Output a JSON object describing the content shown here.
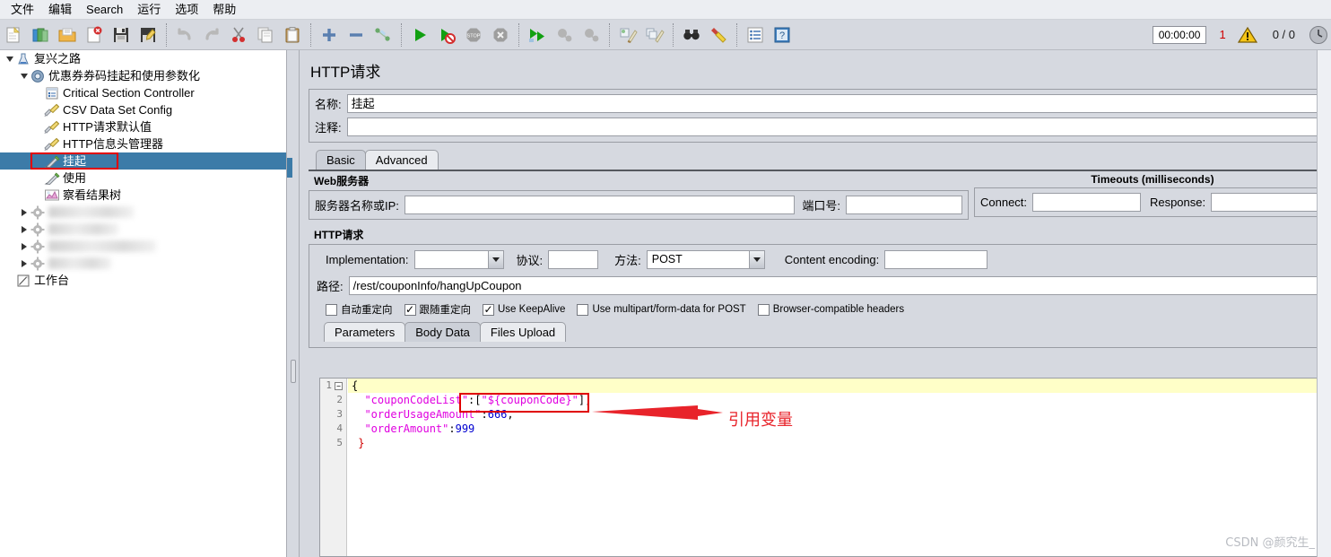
{
  "menubar": {
    "items": [
      {
        "label": "文件",
        "name": "menu-file"
      },
      {
        "label": "编辑",
        "name": "menu-edit"
      },
      {
        "label": "Search",
        "name": "menu-search"
      },
      {
        "label": "运行",
        "name": "menu-run"
      },
      {
        "label": "选项",
        "name": "menu-options"
      },
      {
        "label": "帮助",
        "name": "menu-help"
      }
    ]
  },
  "toolbar": {
    "icons": [
      "new-icon",
      "templates-icon",
      "open-icon",
      "close-icon",
      "save-icon",
      "save-as-icon",
      "undo-icon",
      "redo-icon",
      "cut-icon",
      "copy-icon",
      "paste-icon",
      "expand-icon",
      "collapse-icon",
      "toggle-icon",
      "start-icon",
      "start-no-pause-icon",
      "stop-icon",
      "shutdown-icon",
      "remote-start-icon",
      "remote-stop-icon",
      "remote-shutdown-icon",
      "clear-icon",
      "clear-all-icon",
      "search-icon",
      "search-reset-icon",
      "function-helper-icon",
      "help-icon"
    ],
    "timer": "00:00:00",
    "warning_count": "1",
    "warning_icon": "warning-triangle-icon",
    "thread_counts": "0 / 0",
    "status_icon": "running-indicator-icon"
  },
  "tree": {
    "nodes": [
      {
        "label": "复兴之路",
        "icon": "test-plan-icon",
        "depth": 0,
        "twisty": "open",
        "selected": false,
        "blurred": false
      },
      {
        "label": "优惠券券码挂起和使用参数化",
        "icon": "thread-group-icon",
        "depth": 1,
        "twisty": "open",
        "selected": false,
        "blurred": false
      },
      {
        "label": "Critical Section Controller",
        "icon": "controller-icon",
        "depth": 2,
        "twisty": "none",
        "selected": false,
        "blurred": false
      },
      {
        "label": "CSV Data Set Config",
        "icon": "config-icon",
        "depth": 2,
        "twisty": "none",
        "selected": false,
        "blurred": false
      },
      {
        "label": "HTTP请求默认值",
        "icon": "config-icon",
        "depth": 2,
        "twisty": "none",
        "selected": false,
        "blurred": false
      },
      {
        "label": "HTTP信息头管理器",
        "icon": "config-icon",
        "depth": 2,
        "twisty": "none",
        "selected": false,
        "blurred": false
      },
      {
        "label": "挂起",
        "icon": "sampler-icon",
        "depth": 2,
        "twisty": "none",
        "selected": true,
        "blurred": false
      },
      {
        "label": "使用",
        "icon": "sampler-icon",
        "depth": 2,
        "twisty": "none",
        "selected": false,
        "blurred": false
      },
      {
        "label": "察看结果树",
        "icon": "listener-icon",
        "depth": 2,
        "twisty": "none",
        "selected": false,
        "blurred": false
      },
      {
        "label": "",
        "icon": "gear-icon",
        "depth": 1,
        "twisty": "closed",
        "selected": false,
        "blurred": true,
        "blur_width": 95
      },
      {
        "label": "",
        "icon": "gear-icon",
        "depth": 1,
        "twisty": "closed",
        "selected": false,
        "blurred": true,
        "blur_width": 78
      },
      {
        "label": "",
        "icon": "gear-icon",
        "depth": 1,
        "twisty": "closed",
        "selected": false,
        "blurred": true,
        "blur_width": 120
      },
      {
        "label": "",
        "icon": "gear-icon",
        "depth": 1,
        "twisty": "closed",
        "selected": false,
        "blurred": true,
        "blur_width": 70
      },
      {
        "label": "工作台",
        "icon": "workbench-icon",
        "depth": 0,
        "twisty": "none",
        "selected": false,
        "blurred": false
      }
    ]
  },
  "panel": {
    "title": "HTTP请求",
    "name_label": "名称:",
    "name_value": "挂起",
    "comment_label": "注释:",
    "comment_value": "",
    "tabs": [
      {
        "label": "Basic",
        "active": true
      },
      {
        "label": "Advanced",
        "active": false
      }
    ],
    "webserver": {
      "group_title": "Web服务器",
      "server_label": "服务器名称或IP:",
      "server_value": "",
      "port_label": "端口号:",
      "port_value": ""
    },
    "timeouts": {
      "group_title": "Timeouts (milliseconds)",
      "connect_label": "Connect:",
      "connect_value": "",
      "response_label": "Response:",
      "response_value": ""
    },
    "httprequest": {
      "group_title": "HTTP请求",
      "implementation_label": "Implementation:",
      "implementation_value": "",
      "protocol_label": "协议:",
      "protocol_value": "",
      "method_label": "方法:",
      "method_value": "POST",
      "content_encoding_label": "Content encoding:",
      "content_encoding_value": "",
      "path_label": "路径:",
      "path_value": "/rest/couponInfo/hangUpCoupon"
    },
    "checkboxes": [
      {
        "label": "自动重定向",
        "checked": false,
        "name": "auto-redirect-checkbox"
      },
      {
        "label": "跟随重定向",
        "checked": true,
        "name": "follow-redirect-checkbox"
      },
      {
        "label": "Use KeepAlive",
        "checked": true,
        "name": "keepalive-checkbox"
      },
      {
        "label": "Use multipart/form-data for POST",
        "checked": false,
        "name": "multipart-checkbox"
      },
      {
        "label": "Browser-compatible headers",
        "checked": false,
        "name": "browser-headers-checkbox"
      }
    ],
    "data_tabs": [
      {
        "label": "Parameters",
        "active": false
      },
      {
        "label": "Body Data",
        "active": true
      },
      {
        "label": "Files Upload",
        "active": false
      }
    ]
  },
  "editor": {
    "line_numbers": [
      "1",
      "2",
      "3",
      "4",
      "5"
    ],
    "fold_marker": "⊟",
    "lines": [
      {
        "n": 1,
        "current": true,
        "tokens": [
          {
            "t": "{",
            "c": "p"
          }
        ]
      },
      {
        "n": 2,
        "current": false,
        "tokens": [
          {
            "t": "  ",
            "c": "p"
          },
          {
            "t": "\"couponCodeList\"",
            "c": "str"
          },
          {
            "t": ":[",
            "c": "p"
          },
          {
            "t": "\"${couponCode}\"",
            "c": "str"
          },
          {
            "t": "],",
            "c": "p"
          }
        ]
      },
      {
        "n": 3,
        "current": false,
        "tokens": [
          {
            "t": "  ",
            "c": "p"
          },
          {
            "t": "\"orderUsageAmount\"",
            "c": "str"
          },
          {
            "t": ":",
            "c": "p"
          },
          {
            "t": "666",
            "c": "num"
          },
          {
            "t": ",",
            "c": "p"
          }
        ]
      },
      {
        "n": 4,
        "current": false,
        "tokens": [
          {
            "t": "  ",
            "c": "p"
          },
          {
            "t": "\"orderAmount\"",
            "c": "str"
          },
          {
            "t": ":",
            "c": "p"
          },
          {
            "t": "999",
            "c": "num"
          }
        ]
      },
      {
        "n": 5,
        "current": false,
        "tokens": [
          {
            "t": " ",
            "c": "p"
          },
          {
            "t": "}",
            "c": "brace-hl"
          }
        ]
      }
    ]
  },
  "annotation": {
    "text": "引用变量",
    "color": "#e8232a",
    "arrow_icon": "right-arrow-annotation-icon",
    "highlight_color": "#e00000"
  },
  "watermark": {
    "text": "CSDN @颜究生_"
  },
  "colors": {
    "selection": "#3c7ba8",
    "panel_bg": "#d6d9e0",
    "annotation_red": "#e8232a",
    "current_line": "#ffffc8",
    "string_token": "#e000e0",
    "number_token": "#0000d0"
  }
}
